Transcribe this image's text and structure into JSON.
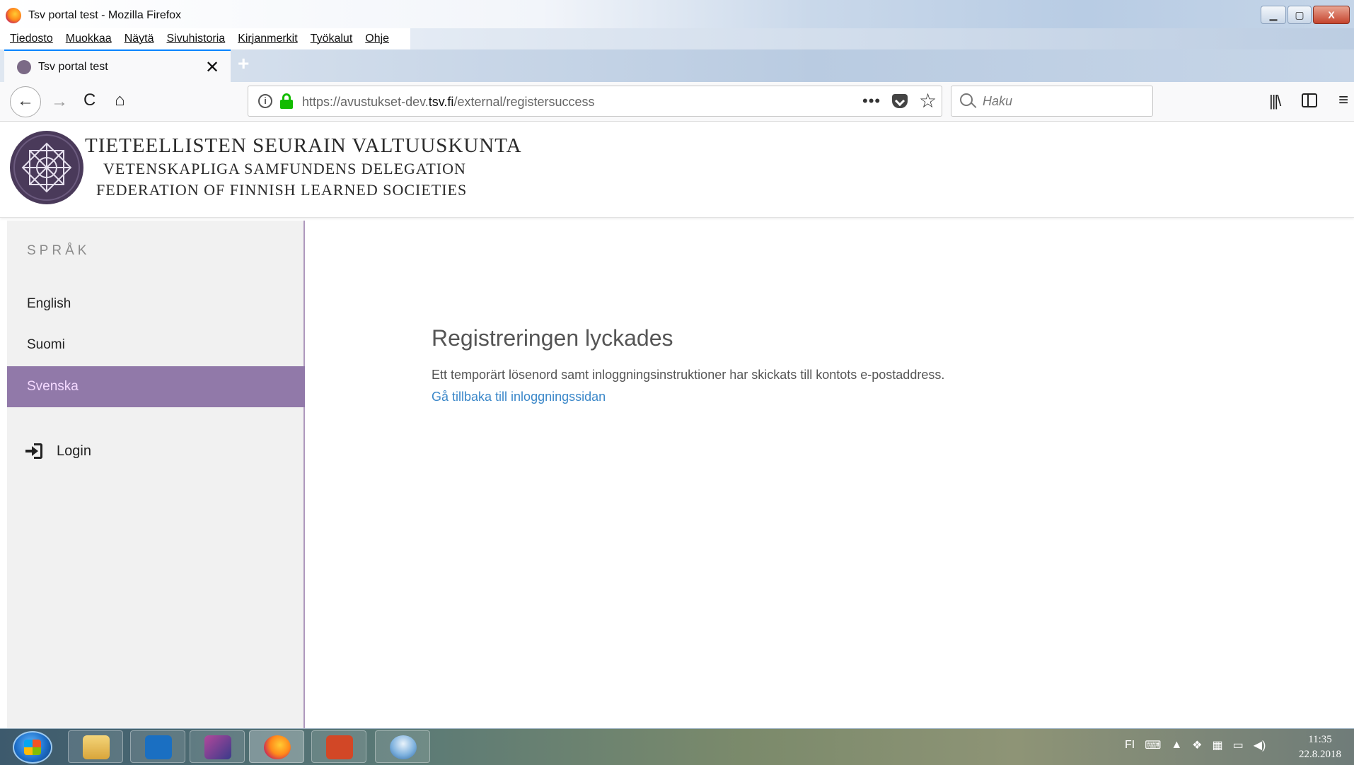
{
  "window": {
    "title": "Tsv portal test - Mozilla Firefox",
    "min_glyph": "▁",
    "max_glyph": "▢",
    "close_glyph": "X"
  },
  "menubar": {
    "items": [
      "Tiedosto",
      "Muokkaa",
      "Näytä",
      "Sivuhistoria",
      "Kirjanmerkit",
      "Työkalut",
      "Ohje"
    ]
  },
  "tab": {
    "title": "Tsv portal test",
    "close_glyph": "✕",
    "new_tab_glyph": "+"
  },
  "navbar": {
    "back_glyph": "←",
    "forward_glyph": "→",
    "reload_glyph": "C",
    "home_glyph": "⌂",
    "url_prefix": "https://avustukset-dev.",
    "url_domain": "tsv.fi",
    "url_path": "/external/registersuccess",
    "more_glyph": "•••",
    "star_glyph": "☆",
    "search_placeholder": "Haku",
    "library_glyph": "|||\\",
    "menu_glyph": "≡"
  },
  "header": {
    "org_fi": "TIETEELLISTEN SEURAIN VALTUUSKUNTA",
    "org_sv": "VETENSKAPLIGA SAMFUNDENS DELEGATION",
    "org_en": "FEDERATION OF FINNISH LEARNED SOCIETIES",
    "logo_color": "#4a3a5a"
  },
  "sidebar": {
    "heading": "SPRÅK",
    "languages": [
      "English",
      "Suomi",
      "Svenska"
    ],
    "active_language": "Svenska",
    "active_color": "#9179a9",
    "login_label": "Login"
  },
  "main": {
    "title": "Registreringen lyckades",
    "message": "Ett temporärt lösenord samt inloggningsinstruktioner har skickats till kontots e-postaddress.",
    "link_text": "Gå tillbaka till inloggningssidan",
    "link_color": "#3a87c9"
  },
  "taskbar": {
    "tray_lang": "FI",
    "tray_icons": [
      "keyboard-icon",
      "chevron-up-icon",
      "dropbox-icon",
      "network-adapter-icon",
      "action-center-icon",
      "volume-icon"
    ],
    "time": "11:35",
    "date": "22.8.2018"
  }
}
